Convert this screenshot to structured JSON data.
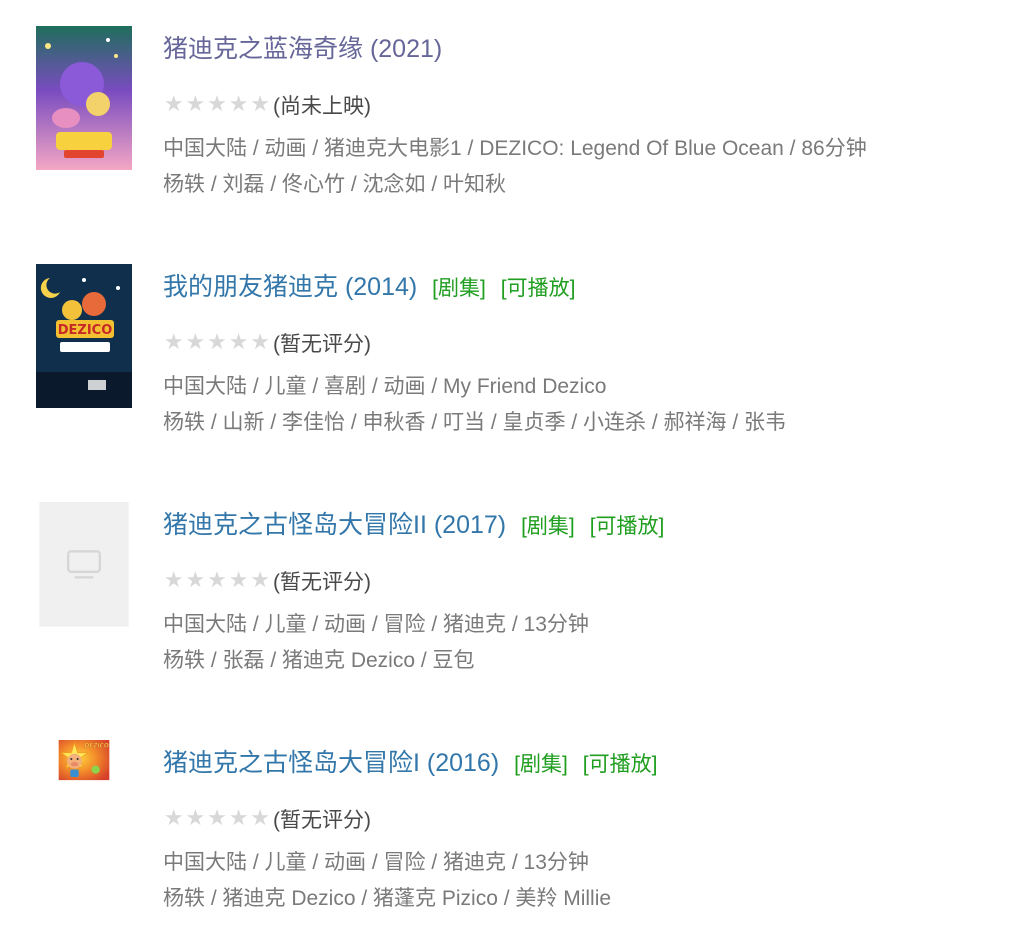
{
  "items": [
    {
      "title": "猪迪克之蓝海奇缘 (2021)",
      "visited": true,
      "tags": [],
      "rating_text": "(尚未上映)",
      "info": "中国大陆 / 动画 / 猪迪克大电影1 / DEZICO: Legend Of Blue Ocean / 86分钟",
      "cast": "杨轶 / 刘磊 / 佟心竹 / 沈念如 / 叶知秋",
      "poster": "poster-bluesea"
    },
    {
      "title": "我的朋友猪迪克 (2014)",
      "visited": false,
      "tags": [
        "[剧集]",
        "[可播放]"
      ],
      "rating_text": "(暂无评分)",
      "info": "中国大陆 / 儿童 / 喜剧 / 动画 / My Friend Dezico",
      "cast": "杨轶 / 山新 / 李佳怡 / 申秋香 / 叮当 / 皇贞季 / 小连杀 / 郝祥海 / 张韦",
      "poster": "poster-friend"
    },
    {
      "title": "猪迪克之古怪岛大冒险II (2017)",
      "visited": false,
      "tags": [
        "[剧集]",
        "[可播放]"
      ],
      "rating_text": "(暂无评分)",
      "info": "中国大陆 / 儿童 / 动画 / 冒险 / 猪迪克 / 13分钟",
      "cast": "杨轶 / 张磊 / 猪迪克 Dezico / 豆包",
      "poster": "poster-placeholder"
    },
    {
      "title": "猪迪克之古怪岛大冒险I (2016)",
      "visited": false,
      "tags": [
        "[剧集]",
        "[可播放]"
      ],
      "rating_text": "(暂无评分)",
      "info": "中国大陆 / 儿童 / 动画 / 冒险 / 猪迪克 / 13分钟",
      "cast": "杨轶 / 猪迪克 Dezico / 猪蓬克 Pizico / 美羚 Millie",
      "poster": "poster-island"
    }
  ],
  "rating_stars": "★★★★★",
  "poster_logo_text": "DEZICO",
  "colors": {
    "link": "#3377aa",
    "visited_link": "#666699",
    "tag_green": "#1f9e1f",
    "meta_gray": "#7a7a7a",
    "star_gray": "#d8d8d8"
  }
}
